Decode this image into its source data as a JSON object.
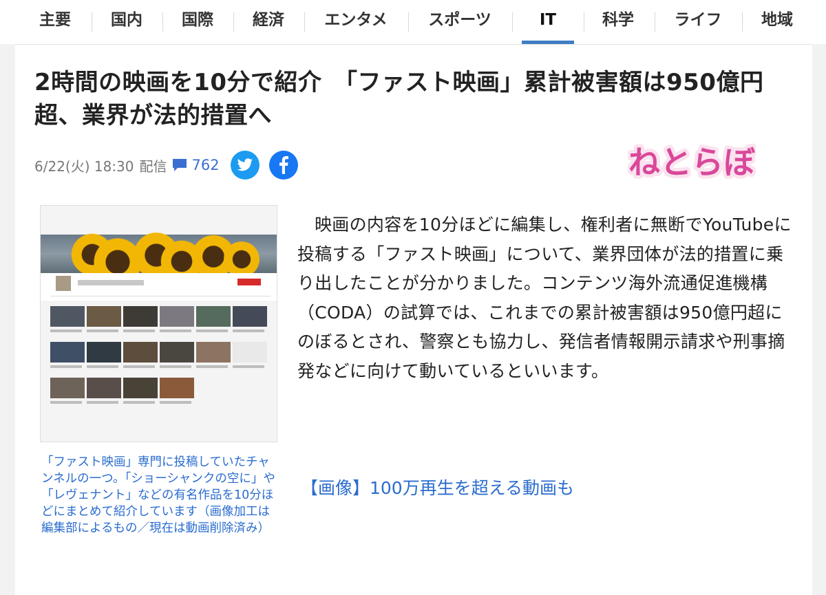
{
  "nav": {
    "items": [
      {
        "label": "主要"
      },
      {
        "label": "国内"
      },
      {
        "label": "国際"
      },
      {
        "label": "経済"
      },
      {
        "label": "エンタメ"
      },
      {
        "label": "スポーツ"
      },
      {
        "label": "IT"
      },
      {
        "label": "科学"
      },
      {
        "label": "ライフ"
      },
      {
        "label": "地域"
      }
    ],
    "active": "IT"
  },
  "article": {
    "headline": "2時間の映画を10分で紹介　「ファスト映画」累計被害額は950億円超、業界が法的措置へ",
    "date": "6/22(火) 18:30",
    "published_label": "配信",
    "comment_count": "762",
    "source_logo": "ねとらぼ",
    "image_caption": "「ファスト映画」専門に投稿していたチャンネルの一つ。「ショーシャンクの空に」や「レヴェナント」などの有名作品を10分ほどにまとめて紹介しています（画像加工は編集部によるもの／現在は動画削除済み）",
    "body": "映画の内容を10分ほどに編集し、権利者に無断でYouTubeに投稿する「ファスト映画」について、業界団体が法的措置に乗り出したことが分かりました。コンテンツ海外流通促進機構（CODA）の試算では、これまでの累計被害額は950億円超にのぼるとされ、警察とも協力し、発信者情報開示請求や刑事摘発などに向けて動いているといいます。",
    "related_link": "【画像】100万再生を超える動画も"
  },
  "icons": {
    "comment": "comment-bubble-icon",
    "twitter": "twitter-bird-icon",
    "facebook": "facebook-f-icon"
  },
  "colors": {
    "accent": "#3e7dc3",
    "link": "#2a6ccf",
    "twitter": "#1d9bf0",
    "facebook": "#1877f2",
    "logo": "#d9489a"
  }
}
